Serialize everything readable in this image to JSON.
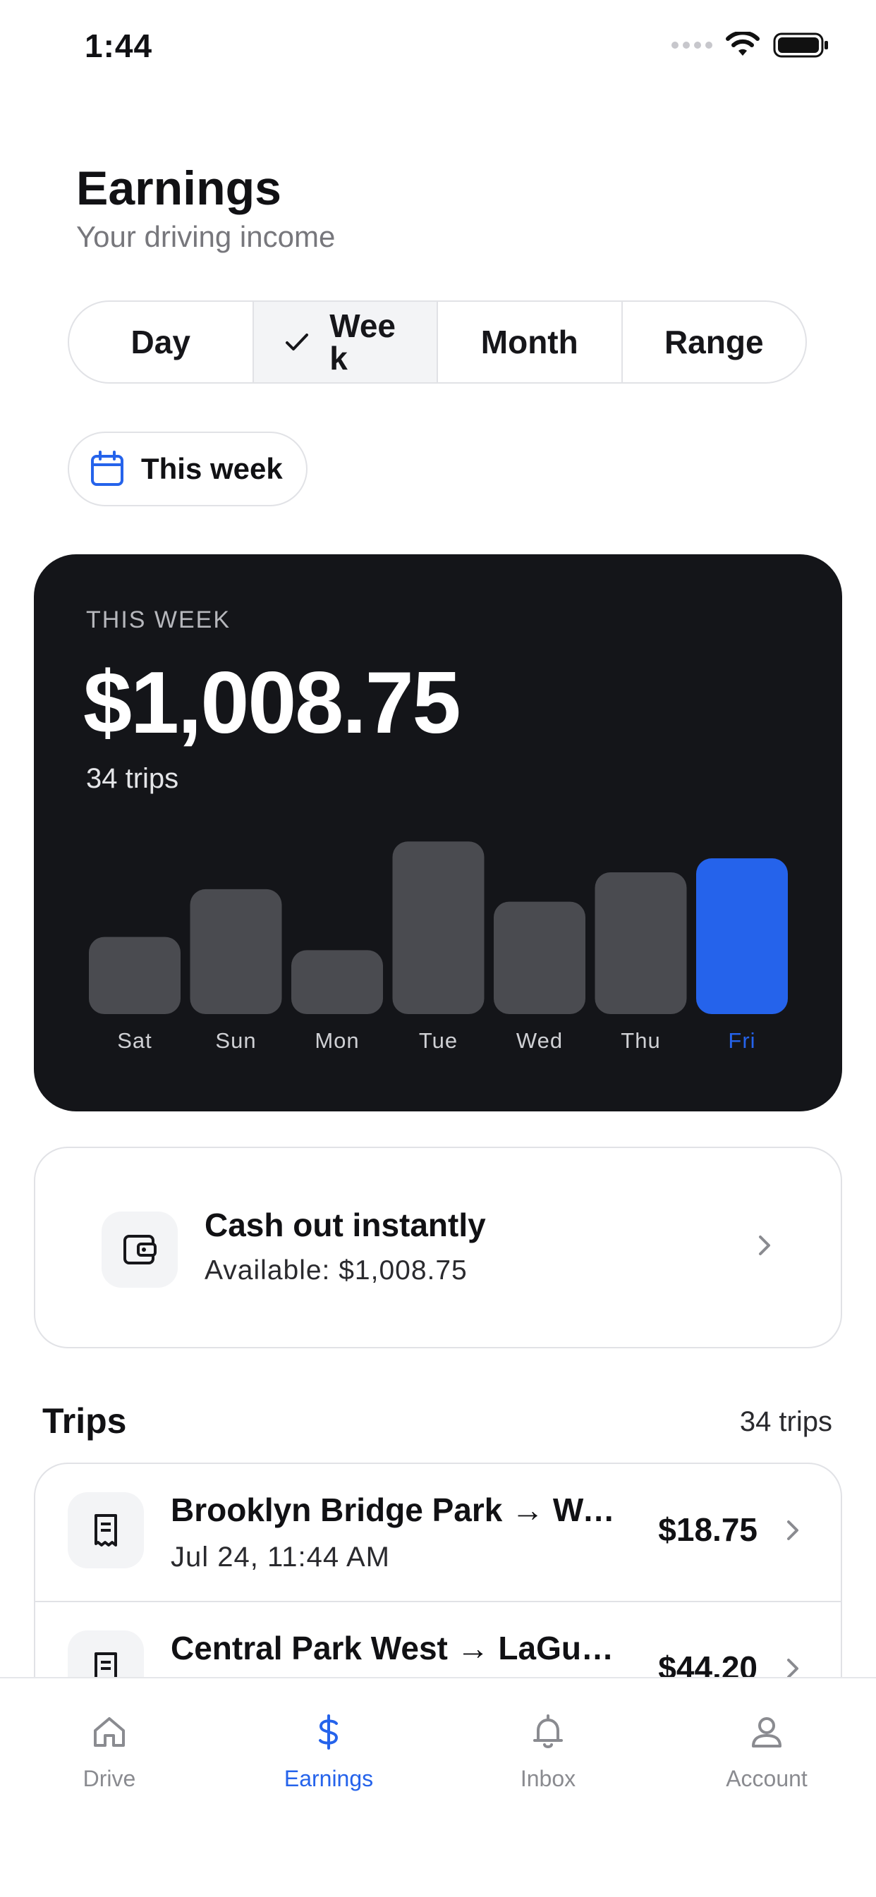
{
  "status_bar": {
    "time": "1:44"
  },
  "header": {
    "title": "Earnings",
    "subtitle": "Your driving income"
  },
  "segments": [
    {
      "label": "Day",
      "active": false
    },
    {
      "label": "Week",
      "active": true
    },
    {
      "label": "Month",
      "active": false
    },
    {
      "label": "Range",
      "active": false
    }
  ],
  "date_chip": {
    "label": "This week"
  },
  "summary": {
    "label": "THIS WEEK",
    "amount": "$1,008.75",
    "trips": "34 trips"
  },
  "chart_data": {
    "type": "bar",
    "categories": [
      "Sat",
      "Sun",
      "Mon",
      "Tue",
      "Wed",
      "Thu",
      "Fri"
    ],
    "values": [
      105,
      170,
      87,
      235,
      153,
      193,
      212
    ],
    "highlight": "Fri",
    "ylim": [
      0,
      240
    ],
    "colors": {
      "bar": "#4a4b50",
      "highlight": "#2563eb",
      "label": "#cfd0d4",
      "highlight_label": "#2563eb"
    }
  },
  "cash_out": {
    "title": "Cash out instantly",
    "subtitle": "Available: $1,008.75"
  },
  "trips_section": {
    "title": "Trips",
    "count": "34 trips",
    "items": [
      {
        "route": "Brooklyn Bridge Park → Wall …",
        "time": "Jul 24, 11:44 AM",
        "amount": "$18.75"
      },
      {
        "route": "Central Park West → LaGuar…",
        "time": "",
        "amount": "$44.20"
      }
    ]
  },
  "tabs": [
    {
      "label": "Drive",
      "icon": "home-icon",
      "active": false
    },
    {
      "label": "Earnings",
      "icon": "dollar-icon",
      "active": true
    },
    {
      "label": "Inbox",
      "icon": "bell-icon",
      "active": false
    },
    {
      "label": "Account",
      "icon": "person-icon",
      "active": false
    }
  ],
  "colors": {
    "accent": "#2563eb",
    "card_bg": "#141519",
    "muted": "#77777c"
  }
}
